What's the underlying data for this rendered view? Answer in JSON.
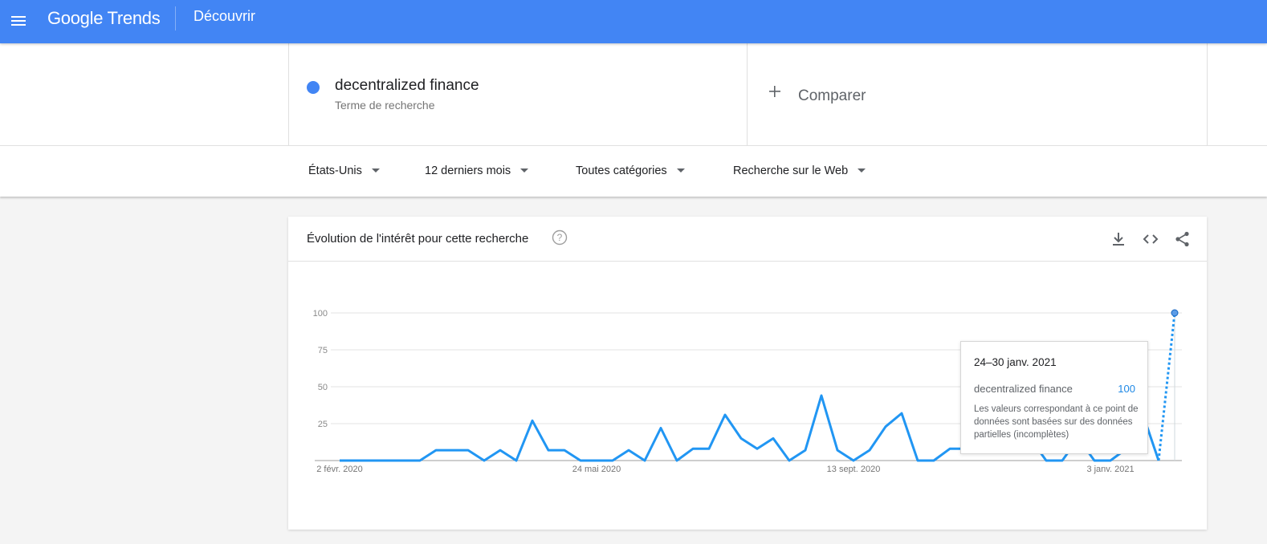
{
  "app": {
    "brand": "Google Trends",
    "section": "Découvrir"
  },
  "search": {
    "term": "decentralized finance",
    "term_subtitle": "Terme de recherche",
    "term_color": "#4285f4",
    "compare_label": "Comparer"
  },
  "filters": [
    {
      "label": "États-Unis"
    },
    {
      "label": "12 derniers mois"
    },
    {
      "label": "Toutes catégories"
    },
    {
      "label": "Recherche sur le Web"
    }
  ],
  "card": {
    "title": "Évolution de l'intérêt pour cette recherche",
    "icons": [
      "help-icon",
      "download-icon",
      "embed-icon",
      "share-icon"
    ]
  },
  "chart_data": {
    "type": "line",
    "series": [
      {
        "name": "decentralized finance",
        "color": "#2196f3",
        "values": [
          0,
          0,
          0,
          0,
          0,
          0,
          7,
          7,
          7,
          0,
          7,
          0,
          27,
          7,
          7,
          0,
          0,
          0,
          7,
          0,
          22,
          0,
          8,
          8,
          31,
          15,
          8,
          15,
          0,
          7,
          44,
          7,
          0,
          7,
          23,
          32,
          0,
          0,
          8,
          8,
          8,
          8,
          8,
          15,
          0,
          0,
          15,
          0,
          0,
          8,
          32,
          0,
          100
        ]
      }
    ],
    "x_tick_labels": [
      "2 févr. 2020",
      "24 mai 2020",
      "13 sept. 2020",
      "3 janv. 2021"
    ],
    "x_tick_indices": [
      0,
      16,
      32,
      48
    ],
    "y_ticks": [
      25,
      50,
      75,
      100
    ],
    "ylim": [
      0,
      100
    ],
    "partial_from_index": 51,
    "highlight_index": 52,
    "grid": true
  },
  "tooltip": {
    "date": "24–30 janv. 2021",
    "term": "decentralized finance",
    "value": "100",
    "note": "Les valeurs correspondant à ce point de données sont basées sur des données partielles (incomplètes)"
  }
}
